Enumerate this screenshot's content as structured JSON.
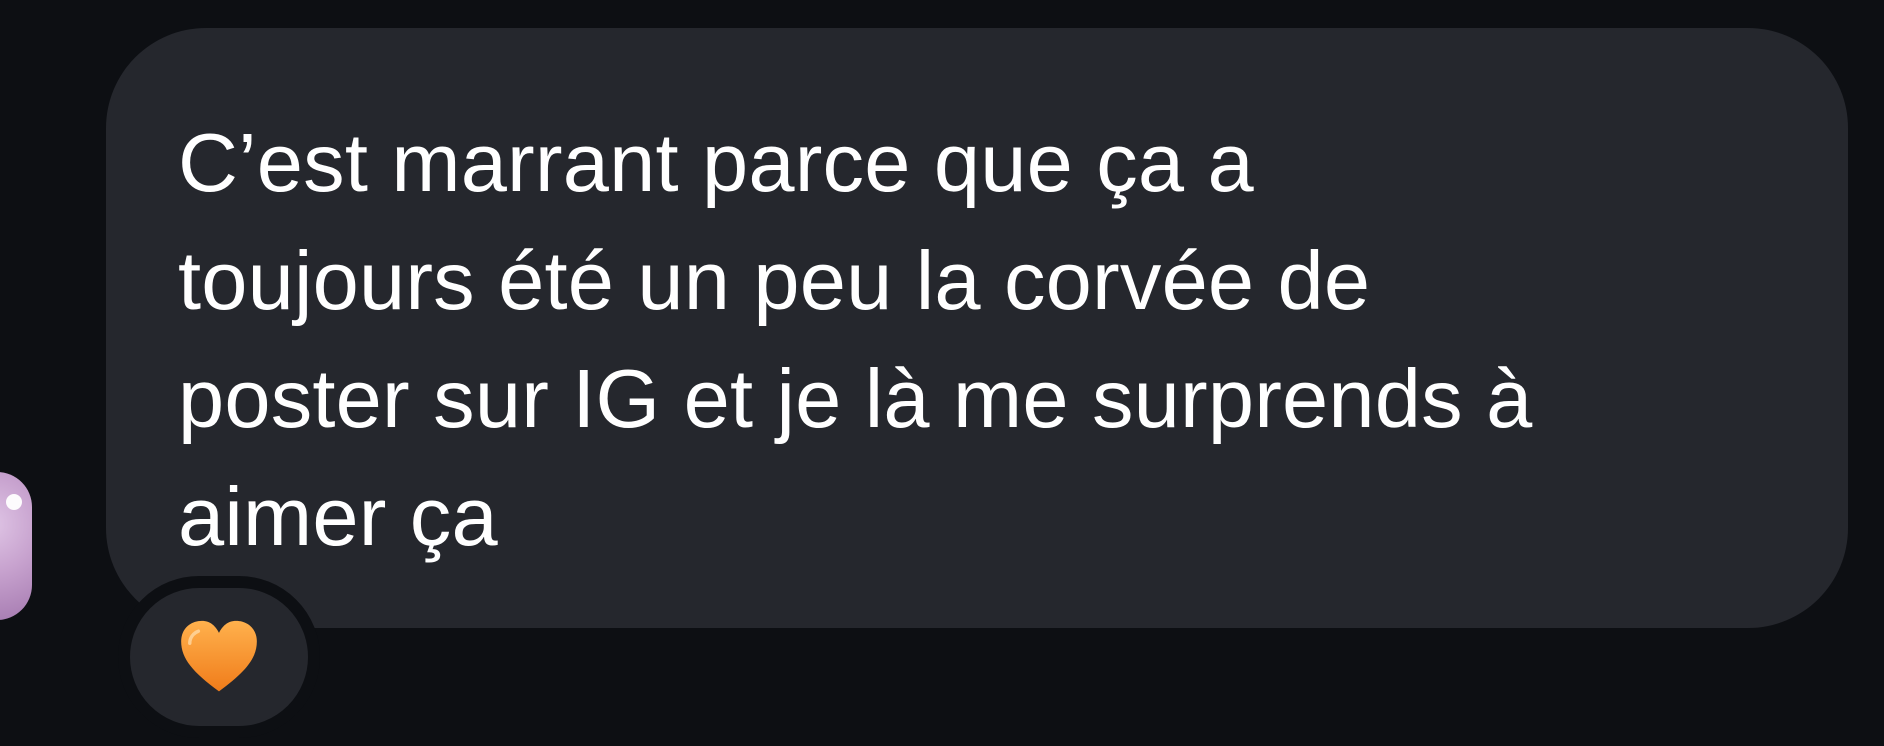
{
  "message": {
    "text": "C’est marrant parce que ça a\ntoujours été un peu la corvée de\nposter sur IG et je là me surprends à\naimer ça"
  },
  "reaction": {
    "emoji_name": "orange-heart-icon",
    "color": "#f5922f"
  },
  "colors": {
    "background": "#0d0f13",
    "bubble": "#25272d",
    "text": "#ffffff"
  }
}
